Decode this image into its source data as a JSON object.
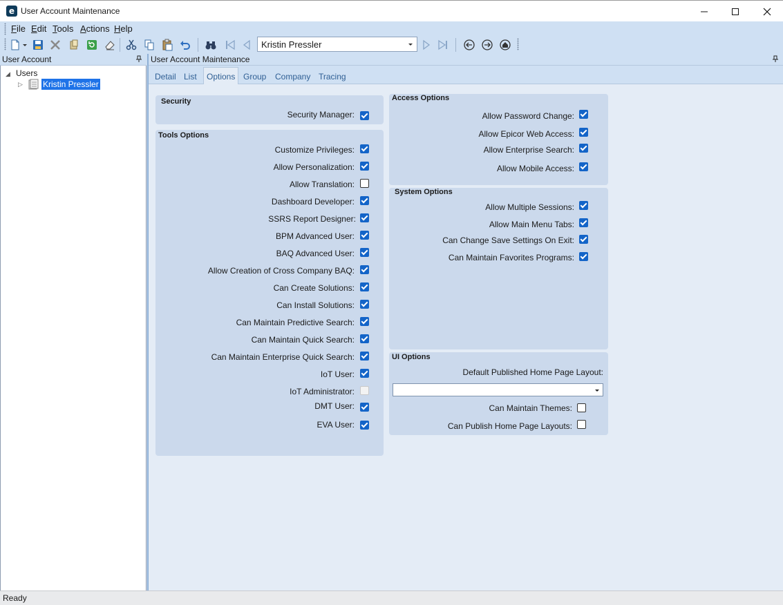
{
  "window": {
    "title": "User Account Maintenance"
  },
  "menu": [
    {
      "key": "F",
      "rest": "ile"
    },
    {
      "key": "E",
      "rest": "dit"
    },
    {
      "key": "T",
      "rest": "ools"
    },
    {
      "key": "A",
      "rest": "ctions"
    },
    {
      "key": "H",
      "rest": "elp"
    }
  ],
  "toolbar": {
    "navigator_value": "Kristin Pressler"
  },
  "left_panel": {
    "title": "User Account",
    "tree": {
      "root_label": "Users",
      "child_label": "Kristin Pressler"
    }
  },
  "right_panel": {
    "title": "User Account Maintenance",
    "tabs": [
      "Detail",
      "List",
      "Options",
      "Group",
      "Company",
      "Tracing"
    ],
    "active_tab": "Options"
  },
  "security": {
    "title": "Security",
    "options": [
      {
        "label": "Security Manager:",
        "checked": true
      }
    ]
  },
  "tools_options": {
    "title": "Tools Options",
    "options": [
      {
        "label": "Customize Privileges:",
        "state": "on"
      },
      {
        "label": "Allow Personalization:",
        "state": "on"
      },
      {
        "label": "Allow Translation:",
        "state": "off"
      },
      {
        "label": "Dashboard Developer:",
        "state": "on"
      },
      {
        "label": "SSRS Report Designer:",
        "state": "on"
      },
      {
        "label": "BPM Advanced User:",
        "state": "on"
      },
      {
        "label": "BAQ Advanced User:",
        "state": "on"
      },
      {
        "label": "Allow Creation of Cross Company BAQ:",
        "state": "on"
      },
      {
        "label": "Can Create Solutions:",
        "state": "on"
      },
      {
        "label": "Can Install Solutions:",
        "state": "on"
      },
      {
        "label": "Can Maintain Predictive Search:",
        "state": "on"
      },
      {
        "label": "Can Maintain Quick Search:",
        "state": "on"
      },
      {
        "label": "Can Maintain Enterprise Quick Search:",
        "state": "on"
      },
      {
        "label": "IoT User:",
        "state": "on"
      },
      {
        "label": "IoT Administrator:",
        "state": "disabled"
      },
      {
        "label": "DMT User:",
        "state": "on"
      },
      {
        "label": "EVA User:",
        "state": "on"
      }
    ]
  },
  "access_options": {
    "title": "Access Options",
    "options": [
      {
        "label": "Allow Password Change:",
        "state": "on"
      },
      {
        "label": "Allow Epicor Web Access:",
        "state": "on"
      },
      {
        "label": "Allow Enterprise Search:",
        "state": "on"
      },
      {
        "label": "Allow Mobile Access:",
        "state": "on"
      }
    ]
  },
  "system_options": {
    "title": "System Options",
    "options": [
      {
        "label": "Allow Multiple Sessions:",
        "state": "on"
      },
      {
        "label": "Allow Main Menu Tabs:",
        "state": "on"
      },
      {
        "label": "Can Change Save Settings On Exit:",
        "state": "on"
      },
      {
        "label": "Can Maintain Favorites Programs:",
        "state": "on"
      }
    ]
  },
  "ui_options": {
    "title": "UI Options",
    "layout_label": "Default Published Home Page Layout:",
    "layout_value": "",
    "options": [
      {
        "label": "Can Maintain Themes:",
        "state": "off"
      },
      {
        "label": "Can Publish Home Page Layouts:",
        "state": "off"
      }
    ]
  },
  "status": {
    "text": "Ready"
  }
}
